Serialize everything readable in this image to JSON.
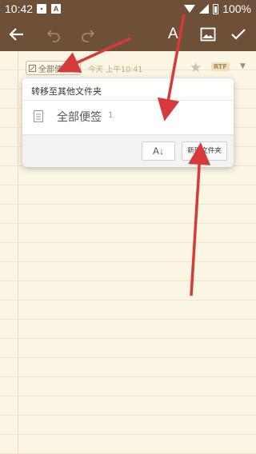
{
  "status_bar": {
    "time": "10:42",
    "notif_icon_1": "gallery-icon",
    "notif_icon_2": "a-badge-icon",
    "battery_percent": "100%"
  },
  "toolbar": {
    "back_icon": "arrow-left-icon",
    "undo_icon": "undo-icon",
    "redo_icon": "redo-icon",
    "text_format_label": "A",
    "image_icon": "image-icon",
    "done_icon": "check-icon",
    "bar_color": "#6e5038"
  },
  "note_meta": {
    "folder_chip_label": "全部便签",
    "date_text": "今天 上午10:41",
    "format_badge": "RTF"
  },
  "popup": {
    "title": "转移至其他文件夹",
    "folders": [
      {
        "name": "全部便签",
        "count": "1"
      }
    ],
    "sort_label": "A↓",
    "new_folder_label": "新建文件夹"
  },
  "annotations": {
    "arrow_color": "#d63a3a"
  }
}
